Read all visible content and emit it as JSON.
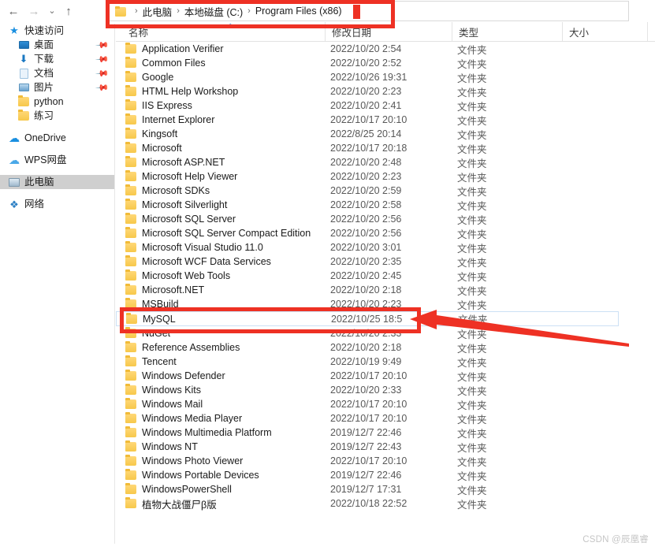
{
  "window": {
    "nav": {
      "back_label": "←",
      "forward_label": "→",
      "history_label": "⌄",
      "up_label": "↑"
    },
    "address": {
      "folder_icon": "folder-icon",
      "crumbs": [
        "此电脑",
        "本地磁盘 (C:)",
        "Program Files (x86)"
      ],
      "separator": "›",
      "cursor_color": "#ee3124"
    }
  },
  "sidebar": {
    "items": [
      {
        "label": "快速访问",
        "icon": "star-icon",
        "indent": 10,
        "pinned": false,
        "selected": false,
        "gap_before": 0
      },
      {
        "label": "桌面",
        "icon": "desktop-icon",
        "indent": 22,
        "pinned": true,
        "selected": false,
        "gap_before": 0
      },
      {
        "label": "下载",
        "icon": "download-icon",
        "indent": 22,
        "pinned": true,
        "selected": false,
        "gap_before": 0
      },
      {
        "label": "文档",
        "icon": "document-icon",
        "indent": 22,
        "pinned": true,
        "selected": false,
        "gap_before": 0
      },
      {
        "label": "图片",
        "icon": "pictures-icon",
        "indent": 22,
        "pinned": true,
        "selected": false,
        "gap_before": 0
      },
      {
        "label": "python",
        "icon": "folder-icon",
        "indent": 22,
        "pinned": false,
        "selected": false,
        "gap_before": 0
      },
      {
        "label": "练习",
        "icon": "folder-icon",
        "indent": 22,
        "pinned": false,
        "selected": false,
        "gap_before": 0
      },
      {
        "label": "OneDrive",
        "icon": "cloud-icon",
        "indent": 10,
        "pinned": false,
        "selected": false,
        "gap_before": 10
      },
      {
        "label": "WPS网盘",
        "icon": "cloud-alt-icon",
        "indent": 10,
        "pinned": false,
        "selected": false,
        "gap_before": 10
      },
      {
        "label": "此电脑",
        "icon": "this-pc-icon",
        "indent": 10,
        "pinned": false,
        "selected": true,
        "gap_before": 10
      },
      {
        "label": "网络",
        "icon": "network-icon",
        "indent": 10,
        "pinned": false,
        "selected": false,
        "gap_before": 10
      }
    ],
    "pin_glyph": "📌"
  },
  "columns": {
    "name": "名称",
    "date_modified": "修改日期",
    "type": "类型",
    "size": "大小",
    "sort_caret": "^",
    "sort_column": "名称",
    "sort_direction": "ascending"
  },
  "files": [
    {
      "name": "Application Verifier",
      "date": "2022/10/20 2:54",
      "type": "文件夹",
      "size": "",
      "selected": false
    },
    {
      "name": "Common Files",
      "date": "2022/10/20 2:52",
      "type": "文件夹",
      "size": "",
      "selected": false
    },
    {
      "name": "Google",
      "date": "2022/10/26 19:31",
      "type": "文件夹",
      "size": "",
      "selected": false
    },
    {
      "name": "HTML Help Workshop",
      "date": "2022/10/20 2:23",
      "type": "文件夹",
      "size": "",
      "selected": false
    },
    {
      "name": "IIS Express",
      "date": "2022/10/20 2:41",
      "type": "文件夹",
      "size": "",
      "selected": false
    },
    {
      "name": "Internet Explorer",
      "date": "2022/10/17 20:10",
      "type": "文件夹",
      "size": "",
      "selected": false
    },
    {
      "name": "Kingsoft",
      "date": "2022/8/25 20:14",
      "type": "文件夹",
      "size": "",
      "selected": false
    },
    {
      "name": "Microsoft",
      "date": "2022/10/17 20:18",
      "type": "文件夹",
      "size": "",
      "selected": false
    },
    {
      "name": "Microsoft ASP.NET",
      "date": "2022/10/20 2:48",
      "type": "文件夹",
      "size": "",
      "selected": false
    },
    {
      "name": "Microsoft Help Viewer",
      "date": "2022/10/20 2:23",
      "type": "文件夹",
      "size": "",
      "selected": false
    },
    {
      "name": "Microsoft SDKs",
      "date": "2022/10/20 2:59",
      "type": "文件夹",
      "size": "",
      "selected": false
    },
    {
      "name": "Microsoft Silverlight",
      "date": "2022/10/20 2:58",
      "type": "文件夹",
      "size": "",
      "selected": false
    },
    {
      "name": "Microsoft SQL Server",
      "date": "2022/10/20 2:56",
      "type": "文件夹",
      "size": "",
      "selected": false
    },
    {
      "name": "Microsoft SQL Server Compact Edition",
      "date": "2022/10/20 2:56",
      "type": "文件夹",
      "size": "",
      "selected": false
    },
    {
      "name": "Microsoft Visual Studio 11.0",
      "date": "2022/10/20 3:01",
      "type": "文件夹",
      "size": "",
      "selected": false
    },
    {
      "name": "Microsoft WCF Data Services",
      "date": "2022/10/20 2:35",
      "type": "文件夹",
      "size": "",
      "selected": false
    },
    {
      "name": "Microsoft Web Tools",
      "date": "2022/10/20 2:45",
      "type": "文件夹",
      "size": "",
      "selected": false
    },
    {
      "name": "Microsoft.NET",
      "date": "2022/10/20 2:18",
      "type": "文件夹",
      "size": "",
      "selected": false
    },
    {
      "name": "MSBuild",
      "date": "2022/10/20 2:23",
      "type": "文件夹",
      "size": "",
      "selected": false
    },
    {
      "name": "MySQL",
      "date": "2022/10/25 18:5",
      "type": "文件夹",
      "size": "",
      "selected": true
    },
    {
      "name": "NuGet",
      "date": "2022/10/20 2:33",
      "type": "文件夹",
      "size": "",
      "selected": false
    },
    {
      "name": "Reference Assemblies",
      "date": "2022/10/20 2:18",
      "type": "文件夹",
      "size": "",
      "selected": false
    },
    {
      "name": "Tencent",
      "date": "2022/10/19 9:49",
      "type": "文件夹",
      "size": "",
      "selected": false
    },
    {
      "name": "Windows Defender",
      "date": "2022/10/17 20:10",
      "type": "文件夹",
      "size": "",
      "selected": false
    },
    {
      "name": "Windows Kits",
      "date": "2022/10/20 2:33",
      "type": "文件夹",
      "size": "",
      "selected": false
    },
    {
      "name": "Windows Mail",
      "date": "2022/10/17 20:10",
      "type": "文件夹",
      "size": "",
      "selected": false
    },
    {
      "name": "Windows Media Player",
      "date": "2022/10/17 20:10",
      "type": "文件夹",
      "size": "",
      "selected": false
    },
    {
      "name": "Windows Multimedia Platform",
      "date": "2019/12/7 22:46",
      "type": "文件夹",
      "size": "",
      "selected": false
    },
    {
      "name": "Windows NT",
      "date": "2019/12/7 22:43",
      "type": "文件夹",
      "size": "",
      "selected": false
    },
    {
      "name": "Windows Photo Viewer",
      "date": "2022/10/17 20:10",
      "type": "文件夹",
      "size": "",
      "selected": false
    },
    {
      "name": "Windows Portable Devices",
      "date": "2019/12/7 22:46",
      "type": "文件夹",
      "size": "",
      "selected": false
    },
    {
      "name": "WindowsPowerShell",
      "date": "2019/12/7 17:31",
      "type": "文件夹",
      "size": "",
      "selected": false
    },
    {
      "name": "植物大战僵尸β版",
      "date": "2022/10/18 22:52",
      "type": "文件夹",
      "size": "",
      "selected": false
    }
  ],
  "annotations": {
    "color": "#ee3124",
    "address_box": "red-highlight-box-address-bar",
    "row_box": "red-highlight-box-mysql-row",
    "arrow": "red-arrow-pointing-to-mysql-row"
  },
  "watermark": {
    "text": "CSDN @辰凰睿"
  }
}
